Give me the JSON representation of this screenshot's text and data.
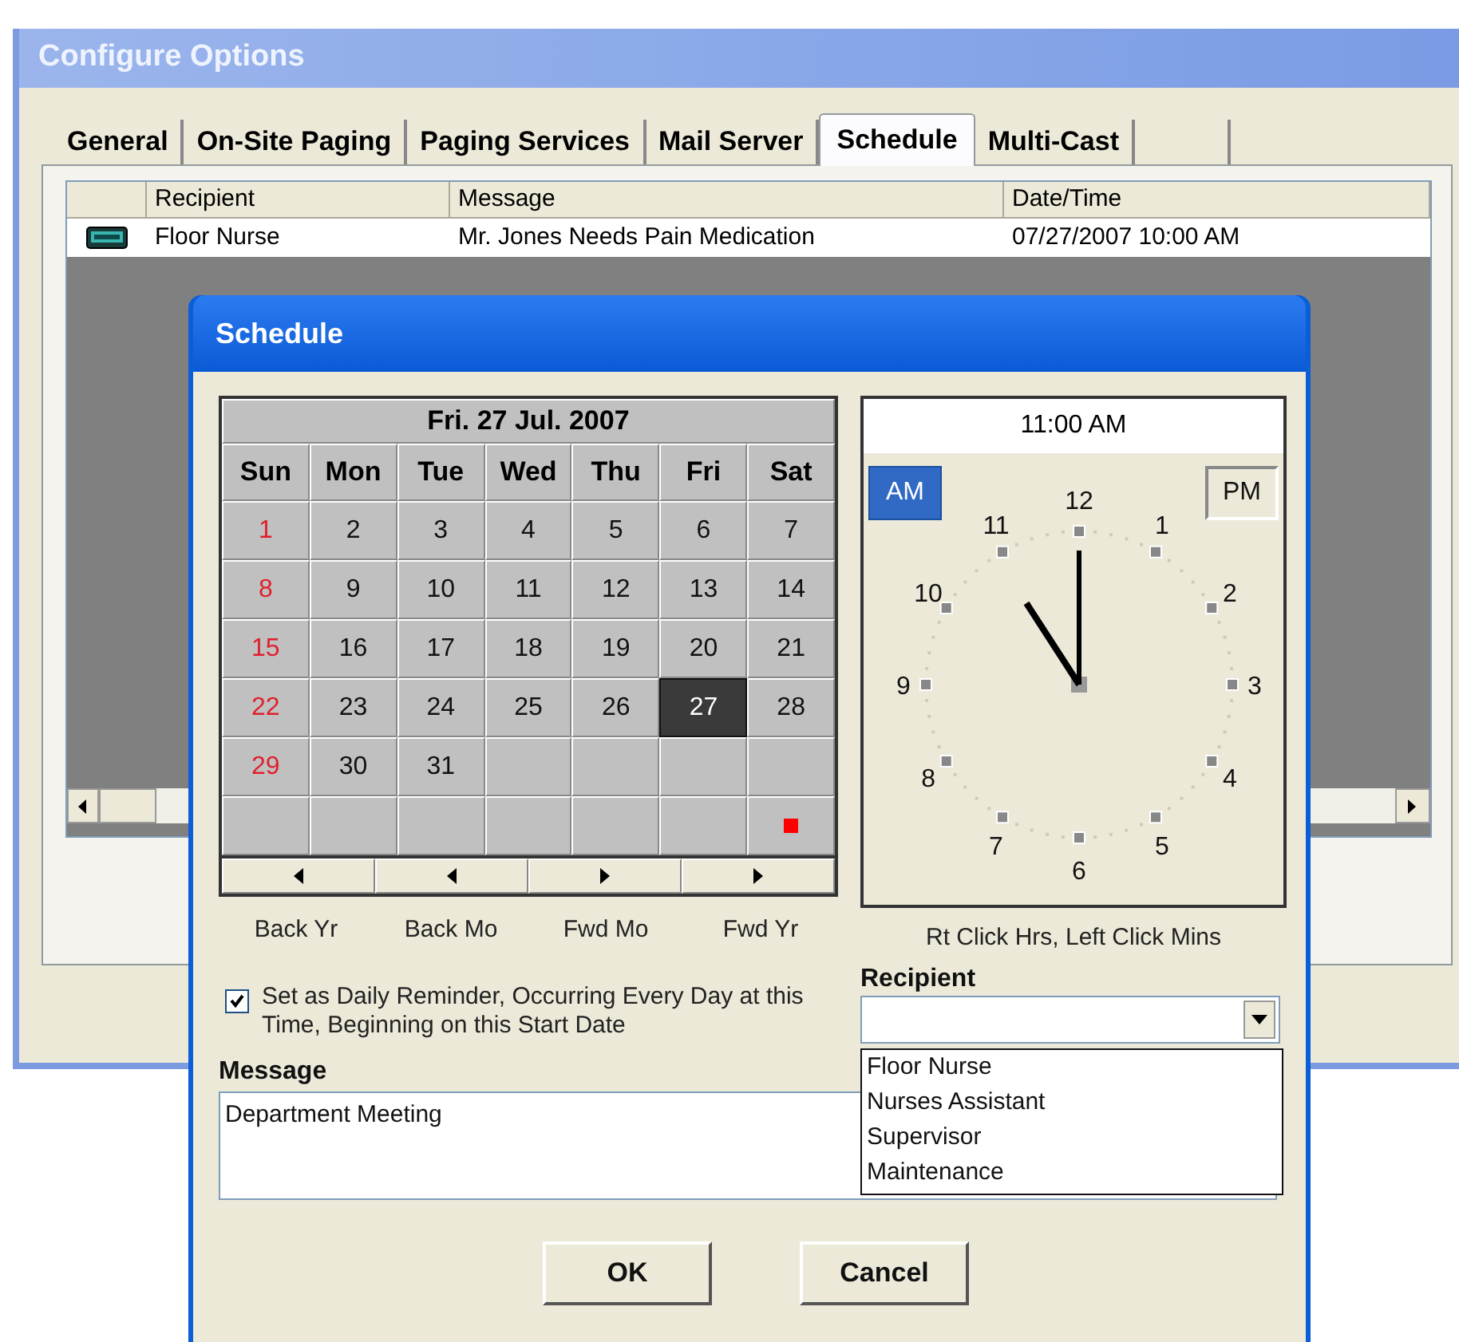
{
  "window": {
    "title": "Configure Options"
  },
  "tabs": [
    {
      "label": "General",
      "selected": false
    },
    {
      "label": "On-Site Paging",
      "selected": false
    },
    {
      "label": "Paging Services",
      "selected": false
    },
    {
      "label": "Mail Server",
      "selected": false
    },
    {
      "label": "Schedule",
      "selected": true
    },
    {
      "label": "Multi-Cast",
      "selected": false
    }
  ],
  "table": {
    "columns": [
      "Recipient",
      "Message",
      "Date/Time"
    ],
    "rows": [
      {
        "cells": [
          "Floor Nurse",
          "Mr. Jones Needs Pain Medication",
          "07/27/2007 10:00 AM"
        ]
      }
    ]
  },
  "dialog": {
    "title": "Schedule",
    "calendar": {
      "header": "Fri. 27 Jul. 2007",
      "weekdays": [
        "Sun",
        "Mon",
        "Tue",
        "Wed",
        "Thu",
        "Fri",
        "Sat"
      ],
      "cells": [
        {
          "kind": "day",
          "label": "1",
          "color": "#e0202c",
          "selected": false
        },
        {
          "kind": "day",
          "label": "2",
          "color": "#111111",
          "selected": false
        },
        {
          "kind": "day",
          "label": "3",
          "color": "#111111",
          "selected": false
        },
        {
          "kind": "day",
          "label": "4",
          "color": "#111111",
          "selected": false
        },
        {
          "kind": "day",
          "label": "5",
          "color": "#111111",
          "selected": false
        },
        {
          "kind": "day",
          "label": "6",
          "color": "#111111",
          "selected": false
        },
        {
          "kind": "day",
          "label": "7",
          "color": "#111111",
          "selected": false
        },
        {
          "kind": "day",
          "label": "8",
          "color": "#e0202c",
          "selected": false
        },
        {
          "kind": "day",
          "label": "9",
          "color": "#111111",
          "selected": false
        },
        {
          "kind": "day",
          "label": "10",
          "color": "#111111",
          "selected": false
        },
        {
          "kind": "day",
          "label": "11",
          "color": "#111111",
          "selected": false
        },
        {
          "kind": "day",
          "label": "12",
          "color": "#111111",
          "selected": false
        },
        {
          "kind": "day",
          "label": "13",
          "color": "#111111",
          "selected": false
        },
        {
          "kind": "day",
          "label": "14",
          "color": "#111111",
          "selected": false
        },
        {
          "kind": "day",
          "label": "15",
          "color": "#e0202c",
          "selected": false
        },
        {
          "kind": "day",
          "label": "16",
          "color": "#111111",
          "selected": false
        },
        {
          "kind": "day",
          "label": "17",
          "color": "#111111",
          "selected": false
        },
        {
          "kind": "day",
          "label": "18",
          "color": "#111111",
          "selected": false
        },
        {
          "kind": "day",
          "label": "19",
          "color": "#111111",
          "selected": false
        },
        {
          "kind": "day",
          "label": "20",
          "color": "#111111",
          "selected": false
        },
        {
          "kind": "day",
          "label": "21",
          "color": "#111111",
          "selected": false
        },
        {
          "kind": "day",
          "label": "22",
          "color": "#e0202c",
          "selected": false
        },
        {
          "kind": "day",
          "label": "23",
          "color": "#111111",
          "selected": false
        },
        {
          "kind": "day",
          "label": "24",
          "color": "#111111",
          "selected": false
        },
        {
          "kind": "day",
          "label": "25",
          "color": "#111111",
          "selected": false
        },
        {
          "kind": "day",
          "label": "26",
          "color": "#111111",
          "selected": false
        },
        {
          "kind": "day",
          "label": "27",
          "color": "#ffffff",
          "selected": true
        },
        {
          "kind": "day",
          "label": "28",
          "color": "#111111",
          "selected": false
        },
        {
          "kind": "day",
          "label": "29",
          "color": "#e0202c",
          "selected": false
        },
        {
          "kind": "day",
          "label": "30",
          "color": "#111111",
          "selected": false
        },
        {
          "kind": "day",
          "label": "31",
          "color": "#111111",
          "selected": false
        },
        {
          "kind": "blank"
        },
        {
          "kind": "blank"
        },
        {
          "kind": "blank"
        },
        {
          "kind": "blank"
        },
        {
          "kind": "blank"
        },
        {
          "kind": "blank"
        },
        {
          "kind": "blank"
        },
        {
          "kind": "blank"
        },
        {
          "kind": "blank"
        },
        {
          "kind": "blank"
        },
        {
          "kind": "marker",
          "color": "#ff0000"
        }
      ],
      "nav": [
        {
          "kind": "back",
          "label": "Back Yr"
        },
        {
          "kind": "back",
          "label": "Back Mo"
        },
        {
          "kind": "forward",
          "label": "Fwd Mo"
        },
        {
          "kind": "forward",
          "label": "Fwd Yr"
        }
      ]
    },
    "clock": {
      "time": "11:00 AM",
      "am": {
        "label": "AM",
        "selected": true
      },
      "pm": {
        "label": "PM",
        "selected": false
      },
      "numbers": [
        "12",
        "1",
        "2",
        "3",
        "4",
        "5",
        "6",
        "7",
        "8",
        "9",
        "10",
        "11"
      ],
      "hint": "Rt Click Hrs, Left Click Mins"
    },
    "daily_reminder": {
      "checked": true,
      "label": "Set as Daily Reminder, Occurring Every Day at this Time, Beginning on this Start Date"
    },
    "recipient": {
      "label": "Recipient",
      "options": [
        {
          "label": "Floor Nurse",
          "selected": false
        },
        {
          "label": "Nurses Assistant",
          "selected": false
        },
        {
          "label": "Supervisor",
          "selected": false
        },
        {
          "label": "Maintenance",
          "selected": false
        }
      ]
    },
    "message": {
      "label": "Message",
      "value": "Department Meeting"
    },
    "buttons": [
      "OK",
      "Cancel"
    ]
  }
}
